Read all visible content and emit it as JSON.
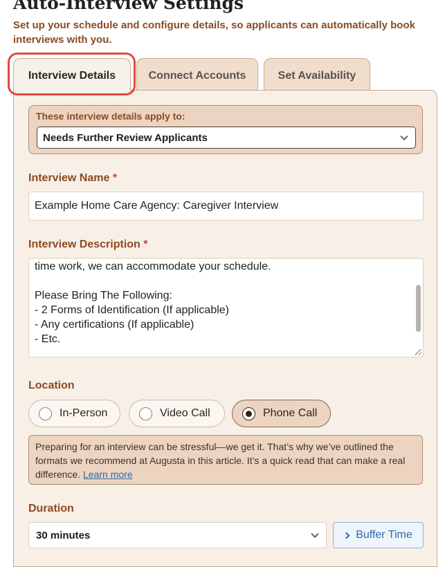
{
  "page": {
    "title": "Auto-Interview Settings",
    "subtitle": "Set up your schedule and configure details, so applicants can automatically book interviews with you."
  },
  "tabs": [
    {
      "label": "Interview Details",
      "active": true
    },
    {
      "label": "Connect Accounts",
      "active": false
    },
    {
      "label": "Set Availability",
      "active": false
    }
  ],
  "applies": {
    "label": "These interview details apply to:",
    "selected": "Needs Further Review Applicants"
  },
  "interview_name": {
    "label": "Interview Name",
    "required_mark": "*",
    "value": "Example Home Care Agency: Caregiver Interview"
  },
  "interview_description": {
    "label": "Interview Description",
    "required_mark": "*",
    "value": "time work, we can accommodate your schedule.\n\nPlease Bring The Following:\n- 2 Forms of Identification (If applicable)\n- Any certifications (If applicable)\n- Etc."
  },
  "location": {
    "label": "Location",
    "options": [
      "In-Person",
      "Video Call",
      "Phone Call"
    ],
    "selected": "Phone Call"
  },
  "info": {
    "text": "Preparing for an interview can be stressful—we get it. That’s why we’ve outlined the formats we recommend at Augusta in this article. It’s a quick read that can make a real difference.",
    "link": "Learn more"
  },
  "duration": {
    "label": "Duration",
    "selected": "30 minutes",
    "buffer_label": "Buffer Time"
  },
  "colors": {
    "accent_brown": "#8a4a22",
    "highlight_red": "#e04a3e",
    "link_blue": "#2c6ba8"
  }
}
